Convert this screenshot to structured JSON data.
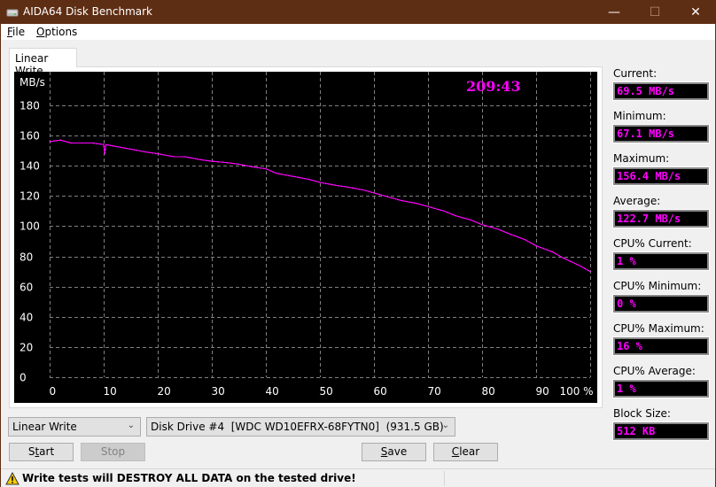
{
  "window": {
    "title": "AIDA64 Disk Benchmark",
    "minimize": "—",
    "maximize": "☐",
    "close": "✕",
    "title_bar_color": "#5e2e14"
  },
  "menu": {
    "items": [
      {
        "label": "File",
        "accel": "F",
        "rest": "ile"
      },
      {
        "label": "Options",
        "accel": "O",
        "rest": "ptions"
      }
    ]
  },
  "tab": {
    "label": "Linear Write"
  },
  "timer": "209:43",
  "stats": [
    {
      "label": "Current:",
      "value": "69.5 MB/s"
    },
    {
      "label": "Minimum:",
      "value": "67.1 MB/s"
    },
    {
      "label": "Maximum:",
      "value": "156.4 MB/s"
    },
    {
      "label": "Average:",
      "value": "122.7 MB/s"
    },
    {
      "label": "CPU% Current:",
      "value": "1 %"
    },
    {
      "label": "CPU% Minimum:",
      "value": "0 %"
    },
    {
      "label": "CPU% Maximum:",
      "value": "16 %"
    },
    {
      "label": "CPU% Average:",
      "value": "1 %"
    },
    {
      "label": "Block Size:",
      "value": "512 KB"
    }
  ],
  "controls": {
    "test_select": "Linear Write",
    "drive_select": "Disk Drive #4  [WDC WD10EFRX-68FYTN0]  (931.5 GB)",
    "start": {
      "accel_pre": "S",
      "accel": "t",
      "post": "art",
      "label": "Start"
    },
    "stop": {
      "label": "Stop"
    },
    "save": {
      "accel": "S",
      "post": "ave",
      "label": "Save"
    },
    "clear": {
      "accel": "C",
      "post": "lear",
      "label": "Clear"
    }
  },
  "status": {
    "warning": "Write tests will DESTROY ALL DATA on the tested drive!"
  },
  "colors": {
    "accent": "#ff00ff",
    "chart_bg": "#000000",
    "grid": "#808080"
  },
  "chart_data": {
    "type": "line",
    "title": "",
    "xlabel": "%",
    "ylabel": "MB/s",
    "xlim": [
      0,
      100
    ],
    "ylim": [
      0,
      180
    ],
    "grid": true,
    "x_ticks": [
      "0",
      "10",
      "20",
      "30",
      "40",
      "50",
      "60",
      "70",
      "80",
      "90",
      "100 %"
    ],
    "y_ticks": [
      "0",
      "20",
      "40",
      "60",
      "80",
      "100",
      "120",
      "140",
      "160",
      "180"
    ],
    "series": [
      {
        "name": "Linear Write",
        "color": "#ff00ff",
        "x": [
          0,
          2,
          4,
          6,
          8,
          10,
          10.2,
          10.4,
          12,
          15,
          18,
          20,
          23,
          25,
          28,
          30,
          33,
          35,
          38,
          40,
          42,
          45,
          48,
          50,
          53,
          55,
          58,
          60,
          63,
          65,
          68,
          70,
          73,
          75,
          78,
          80,
          83,
          85,
          88,
          90,
          93,
          95,
          98,
          100
        ],
        "values": [
          156,
          157,
          155,
          155,
          155,
          154,
          148,
          154,
          153,
          151,
          149,
          148,
          146,
          146,
          144,
          143,
          142,
          141,
          139,
          138,
          135,
          133,
          131,
          129,
          127,
          126,
          124,
          122,
          119,
          117,
          115,
          113,
          110,
          107,
          104,
          101,
          98,
          95,
          91,
          87,
          83,
          79,
          74,
          70
        ]
      }
    ]
  }
}
